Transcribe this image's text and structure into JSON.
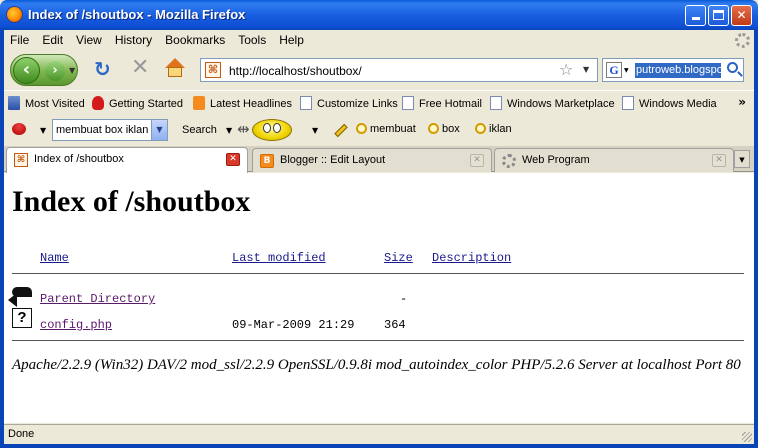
{
  "window": {
    "title": "Index of /shoutbox - Mozilla Firefox"
  },
  "menu": [
    "File",
    "Edit",
    "View",
    "History",
    "Bookmarks",
    "Tools",
    "Help"
  ],
  "nav": {
    "url": "http://localhost/shoutbox/",
    "search_value": "putroweb.blogspot"
  },
  "bookmarks": [
    {
      "label": "Most Visited",
      "icon": "folder-icon"
    },
    {
      "label": "Getting Started",
      "icon": "firefox-icon"
    },
    {
      "label": "Latest Headlines",
      "icon": "rss-icon"
    },
    {
      "label": "Customize Links",
      "icon": "page-icon"
    },
    {
      "label": "Free Hotmail",
      "icon": "page-icon"
    },
    {
      "label": "Windows Marketplace",
      "icon": "page-icon"
    },
    {
      "label": "Windows Media",
      "icon": "page-icon"
    }
  ],
  "toolbar": {
    "combo_value": "membuat box iklan",
    "search_label": "Search",
    "highlights": [
      "membuat",
      "box",
      "iklan"
    ]
  },
  "tabs": [
    {
      "label": "Index of /shoutbox",
      "active": true
    },
    {
      "label": "Blogger :: Edit Layout",
      "active": false
    },
    {
      "label": "Web Program",
      "active": false
    }
  ],
  "page": {
    "heading": "Index of /shoutbox",
    "columns": {
      "name": "Name",
      "modified": "Last modified",
      "size": "Size",
      "description": "Description"
    },
    "rows": [
      {
        "name": "Parent Directory",
        "modified": "",
        "size": "-",
        "description": ""
      },
      {
        "name": "config.php",
        "modified": "09-Mar-2009 21:29",
        "size": "364",
        "description": ""
      }
    ],
    "address": "Apache/2.2.9 (Win32) DAV/2 mod_ssl/2.2.9 OpenSSL/0.9.8i mod_autoindex_color PHP/5.2.6 Server at localhost Port 80"
  },
  "status": {
    "text": "Done"
  }
}
